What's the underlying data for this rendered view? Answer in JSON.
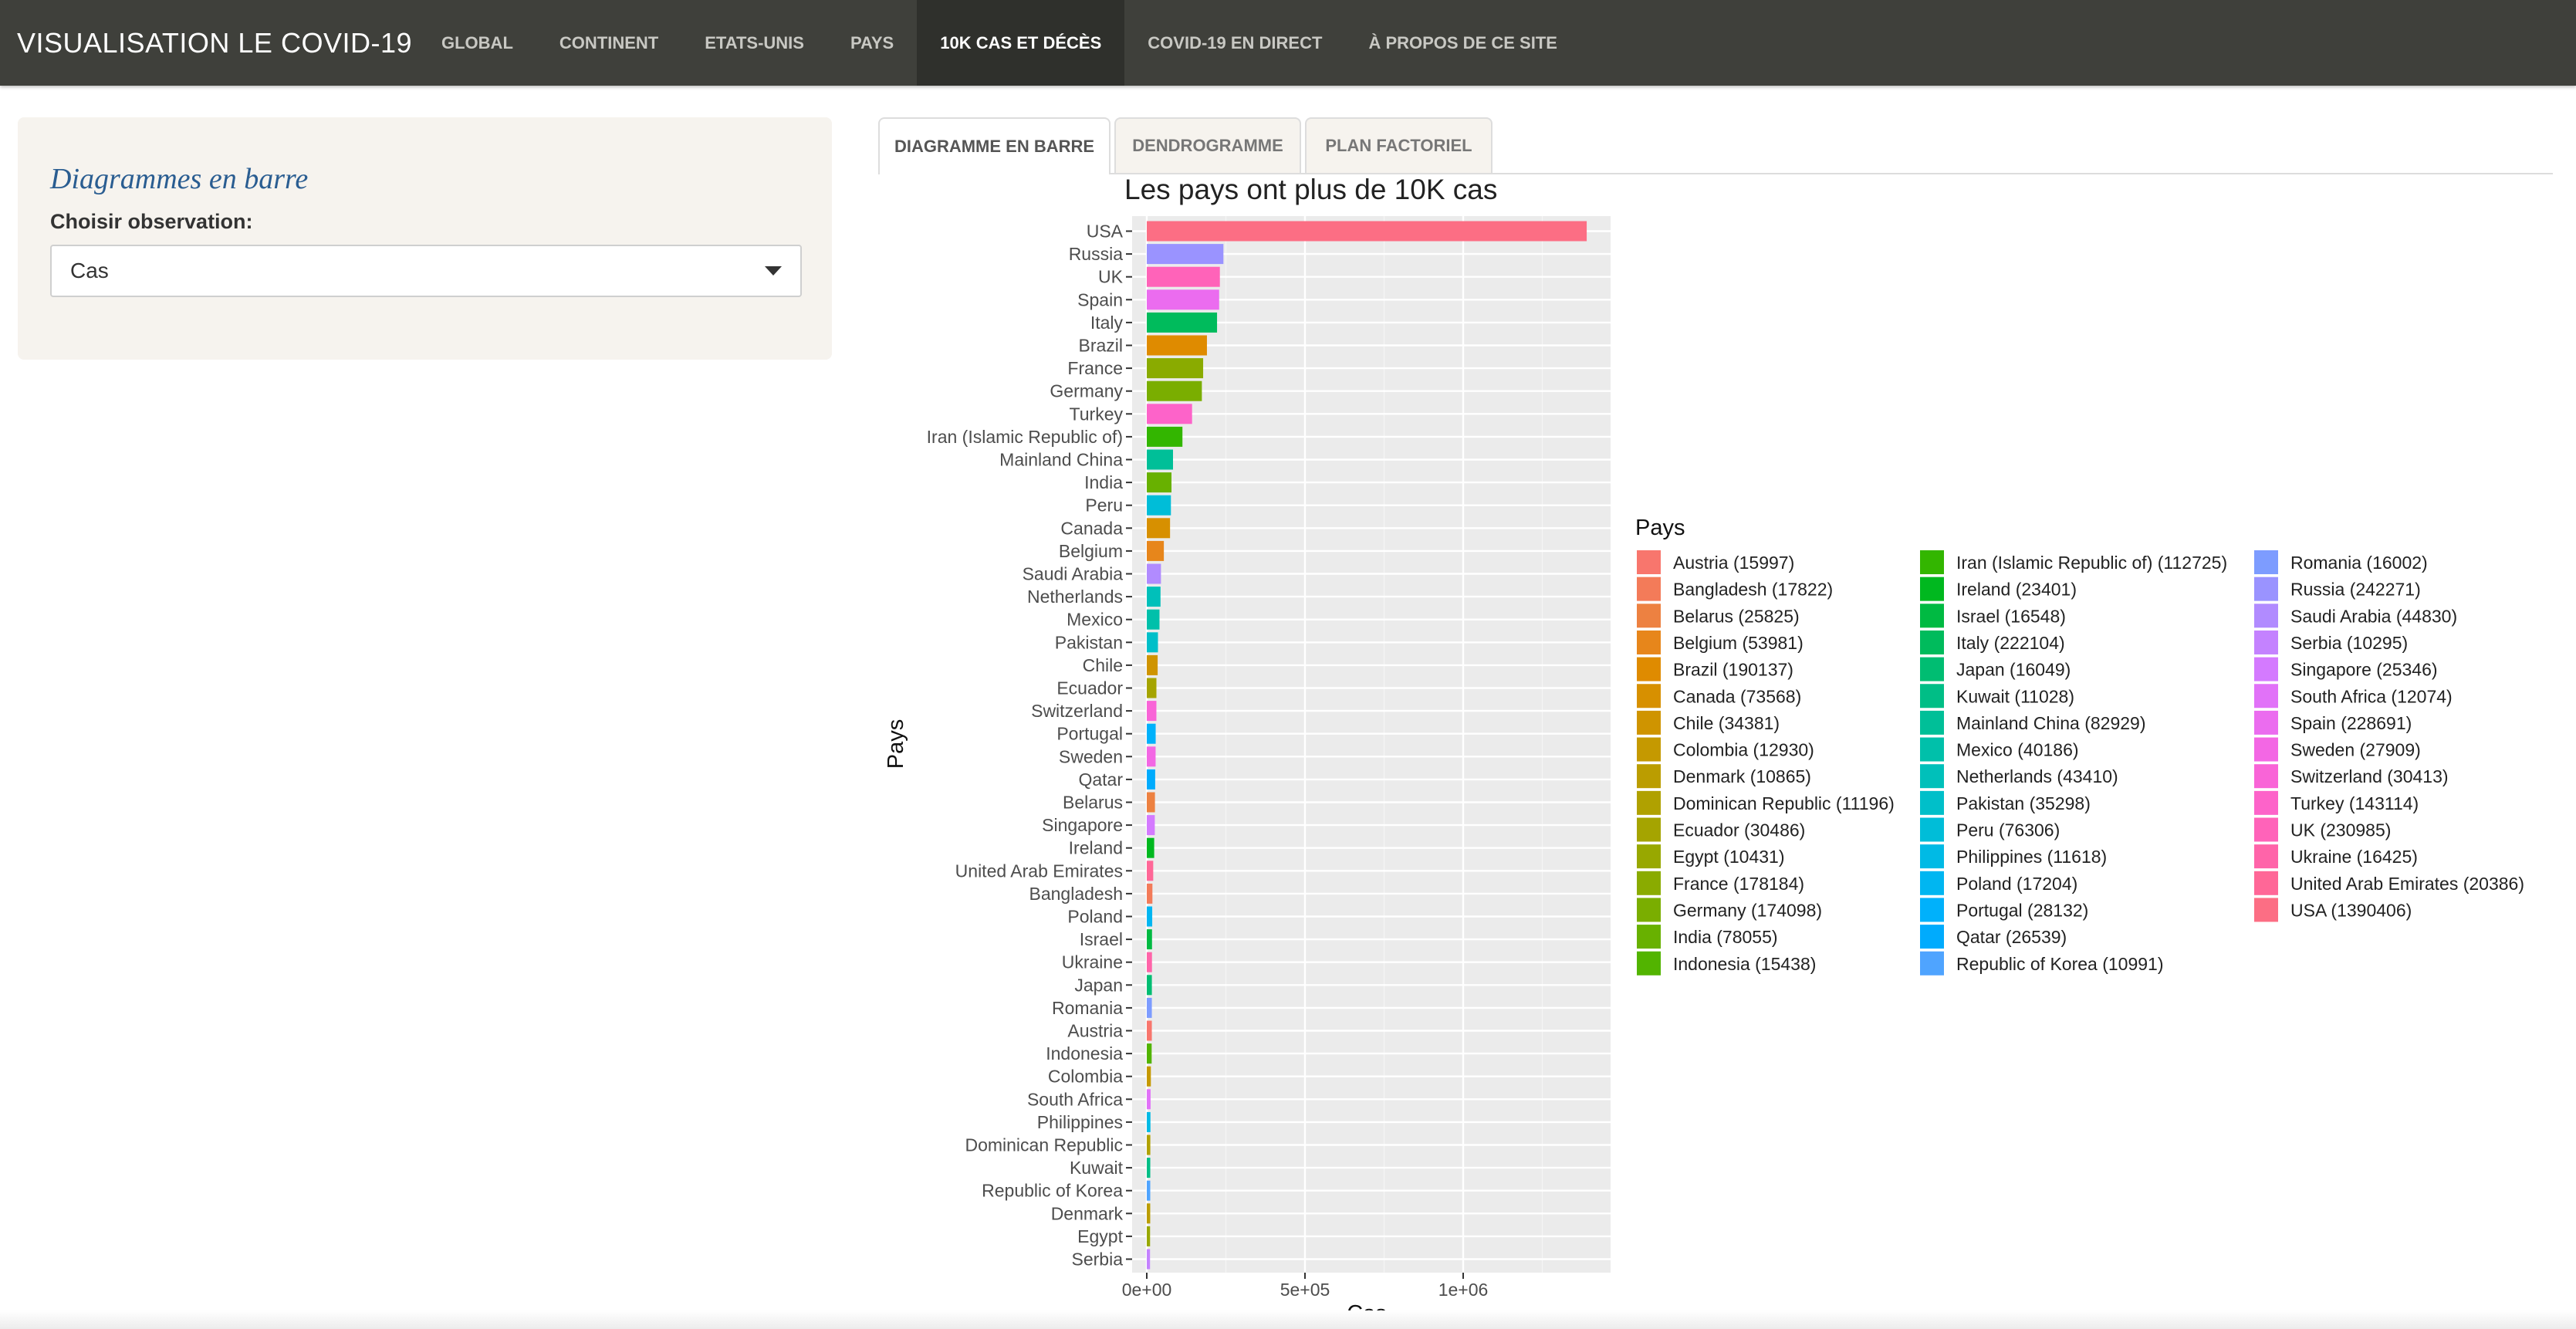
{
  "app": {
    "title": "VISUALISATION LE COVID-19"
  },
  "nav": [
    {
      "label": "GLOBAL"
    },
    {
      "label": "CONTINENT"
    },
    {
      "label": "ETATS-UNIS"
    },
    {
      "label": "PAYS"
    },
    {
      "label": "10K CAS ET DÉCÈS",
      "active": true
    },
    {
      "label": "COVID-19 EN DIRECT"
    },
    {
      "label": "À PROPOS DE CE SITE"
    }
  ],
  "sidebar": {
    "title": "Diagrammes en barre",
    "select_label": "Choisir observation:",
    "select_value": "Cas"
  },
  "tabs": [
    {
      "label": "DIAGRAMME EN BARRE",
      "active": true
    },
    {
      "label": "DENDROGRAMME"
    },
    {
      "label": "PLAN FACTORIEL"
    }
  ],
  "chart_data": {
    "type": "bar",
    "orientation": "horizontal",
    "title": "Les pays ont plus de 10K cas",
    "xlabel": "Cas",
    "ylabel": "Pays",
    "xlim": [
      0,
      1460000
    ],
    "xticks": [
      {
        "value": 0,
        "label": "0e+00"
      },
      {
        "value": 500000,
        "label": "5e+05"
      },
      {
        "value": 1000000,
        "label": "1e+06"
      }
    ],
    "grid": true,
    "legend_title": "Pays",
    "legend_position": "right",
    "categories": [
      "USA",
      "Russia",
      "UK",
      "Spain",
      "Italy",
      "Brazil",
      "France",
      "Germany",
      "Turkey",
      "Iran (Islamic Republic of)",
      "Mainland China",
      "India",
      "Peru",
      "Canada",
      "Belgium",
      "Saudi Arabia",
      "Netherlands",
      "Mexico",
      "Pakistan",
      "Chile",
      "Ecuador",
      "Switzerland",
      "Portugal",
      "Sweden",
      "Qatar",
      "Belarus",
      "Singapore",
      "Ireland",
      "United Arab Emirates",
      "Bangladesh",
      "Poland",
      "Israel",
      "Ukraine",
      "Japan",
      "Romania",
      "Austria",
      "Indonesia",
      "Colombia",
      "South Africa",
      "Philippines",
      "Dominican Republic",
      "Kuwait",
      "Republic of Korea",
      "Denmark",
      "Egypt",
      "Serbia"
    ],
    "values": [
      1390406,
      242271,
      230985,
      228691,
      222104,
      190137,
      178184,
      174098,
      143114,
      112725,
      82929,
      78055,
      76306,
      73568,
      53981,
      44830,
      43410,
      40186,
      35298,
      34381,
      30486,
      30413,
      28132,
      27909,
      26539,
      25825,
      25346,
      23401,
      20386,
      17822,
      17204,
      16548,
      16425,
      16049,
      16002,
      15997,
      15438,
      12930,
      12074,
      11618,
      11196,
      11028,
      10991,
      10865,
      10431,
      10295
    ],
    "legend": [
      {
        "label": "Austria (15997)",
        "color": "#F8766D"
      },
      {
        "label": "Bangladesh (17822)",
        "color": "#F37B59"
      },
      {
        "label": "Belarus (25825)",
        "color": "#ED8141"
      },
      {
        "label": "Belgium (53981)",
        "color": "#E7861B"
      },
      {
        "label": "Brazil (190137)",
        "color": "#DF8B00"
      },
      {
        "label": "Canada (73568)",
        "color": "#D79000"
      },
      {
        "label": "Chile (34381)",
        "color": "#CF9400"
      },
      {
        "label": "Colombia (12930)",
        "color": "#C59900"
      },
      {
        "label": "Denmark (10865)",
        "color": "#BB9D00"
      },
      {
        "label": "Dominican Republic (11196)",
        "color": "#B0A100"
      },
      {
        "label": "Ecuador (30486)",
        "color": "#A5A400"
      },
      {
        "label": "Egypt (10431)",
        "color": "#98A800"
      },
      {
        "label": "France (178184)",
        "color": "#8AAB00"
      },
      {
        "label": "Germany (174098)",
        "color": "#7AAE00"
      },
      {
        "label": "India (78055)",
        "color": "#68B100"
      },
      {
        "label": "Indonesia (15438)",
        "color": "#52B400"
      },
      {
        "label": "Iran (Islamic Republic of) (112725)",
        "color": "#33B600"
      },
      {
        "label": "Ireland (23401)",
        "color": "#00B81F"
      },
      {
        "label": "Israel (16548)",
        "color": "#00BA42"
      },
      {
        "label": "Italy (222104)",
        "color": "#00BB5C"
      },
      {
        "label": "Japan (16049)",
        "color": "#00BD72"
      },
      {
        "label": "Kuwait (11028)",
        "color": "#00BE86"
      },
      {
        "label": "Mainland China (82929)",
        "color": "#00BF98"
      },
      {
        "label": "Mexico (40186)",
        "color": "#00C0AA"
      },
      {
        "label": "Netherlands (43410)",
        "color": "#00C0BA"
      },
      {
        "label": "Pakistan (35298)",
        "color": "#00BFC9"
      },
      {
        "label": "Peru (76306)",
        "color": "#00BDD8"
      },
      {
        "label": "Philippines (11618)",
        "color": "#00BAE5"
      },
      {
        "label": "Poland (17204)",
        "color": "#00B6F1"
      },
      {
        "label": "Portugal (28132)",
        "color": "#00B1FB"
      },
      {
        "label": "Qatar (26539)",
        "color": "#00ABFD"
      },
      {
        "label": "Republic of Korea (10991)",
        "color": "#4FA4FF"
      },
      {
        "label": "Romania (16002)",
        "color": "#7D9CFF"
      },
      {
        "label": "Russia (242271)",
        "color": "#9A93FF"
      },
      {
        "label": "Saudi Arabia (44830)",
        "color": "#B18BFF"
      },
      {
        "label": "Serbia (10295)",
        "color": "#C482FF"
      },
      {
        "label": "Singapore (25346)",
        "color": "#D47AFF"
      },
      {
        "label": "South Africa (12074)",
        "color": "#E172F8"
      },
      {
        "label": "Spain (228691)",
        "color": "#EB6CEF"
      },
      {
        "label": "Sweden (27909)",
        "color": "#F367E4"
      },
      {
        "label": "Switzerland (30413)",
        "color": "#F964D7"
      },
      {
        "label": "Turkey (143114)",
        "color": "#FD63C9"
      },
      {
        "label": "UK (230985)",
        "color": "#FF63B9"
      },
      {
        "label": "Ukraine (16425)",
        "color": "#FF64A9"
      },
      {
        "label": "United Arab Emirates (20386)",
        "color": "#FF6797"
      },
      {
        "label": "USA (1390406)",
        "color": "#FC6E84"
      }
    ]
  }
}
